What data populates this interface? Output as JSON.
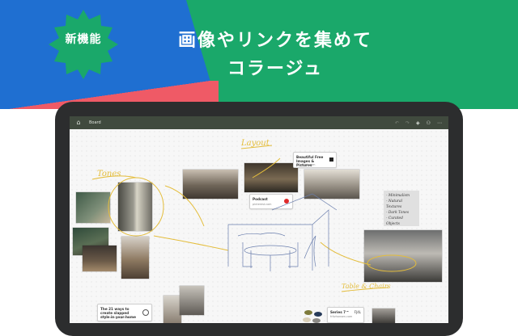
{
  "badge": {
    "label": "新機能"
  },
  "headline": {
    "line1": "画像やリンクを集めて",
    "line2": "コラージュ"
  },
  "colors": {
    "green": "#1aa86a",
    "blue": "#1f6fd1",
    "red": "#ef5a66",
    "toolbar": "#404a3e",
    "handwriting": "#e4bd3b"
  },
  "toolbar": {
    "home_icon": "home-icon",
    "board_label": "Board",
    "icons": [
      "undo-icon",
      "redo-icon",
      "layers-icon",
      "people-icon",
      "more-icon"
    ]
  },
  "canvas": {
    "labels": {
      "tones": "Tones",
      "layout": "Layout",
      "tables": "Table & Chairs"
    },
    "note": [
      "- Minimalism",
      "- Natural Textures",
      "- Dark Tones",
      "- Curated Objects"
    ],
    "cards": {
      "free_images": {
        "title": "Beautiful Free Images & Pictures",
        "subtitle": "unsplash.com"
      },
      "podcast": {
        "title": "Podcast",
        "subtitle": "pinterest.com"
      },
      "article": {
        "title": "The 21 ways to create slapped style in your home",
        "subtitle": "architecturaldigest.com"
      },
      "series": {
        "title": "Series 7™",
        "subtitle": "fritzhansen.com",
        "price": "FJ4L"
      }
    }
  }
}
